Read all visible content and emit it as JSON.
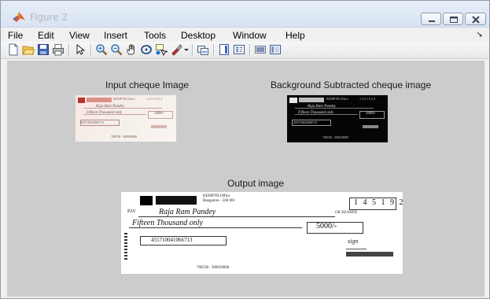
{
  "window": {
    "title": "Figure 2"
  },
  "menu": {
    "items": [
      "File",
      "Edit",
      "View",
      "Insert",
      "Tools",
      "Desktop",
      "Window",
      "Help"
    ]
  },
  "toolbar": {
    "buttons": [
      "new-figure-icon",
      "open-file-icon",
      "save-figure-icon",
      "print-figure-icon",
      "edit-plot-icon",
      "zoom-in-icon",
      "zoom-out-icon",
      "pan-icon",
      "rotate-3d-icon",
      "data-cursor-icon",
      "brush-icon",
      "link-plot-icon",
      "insert-colorbar-icon",
      "insert-legend-icon",
      "hide-plot-tools-icon",
      "show-plot-tools-icon"
    ]
  },
  "figure": {
    "panels": [
      {
        "title": "Input cheque Image"
      },
      {
        "title": "Background Subtracted cheque image"
      },
      {
        "title": "Output image"
      }
    ]
  },
  "cheque": {
    "payee": "Raja Ram Pandey",
    "amount_words": "Fifteen Thousand only",
    "amount": "5000/-",
    "account_no": "455710041066713",
    "micr": "700538 : 300639000"
  }
}
